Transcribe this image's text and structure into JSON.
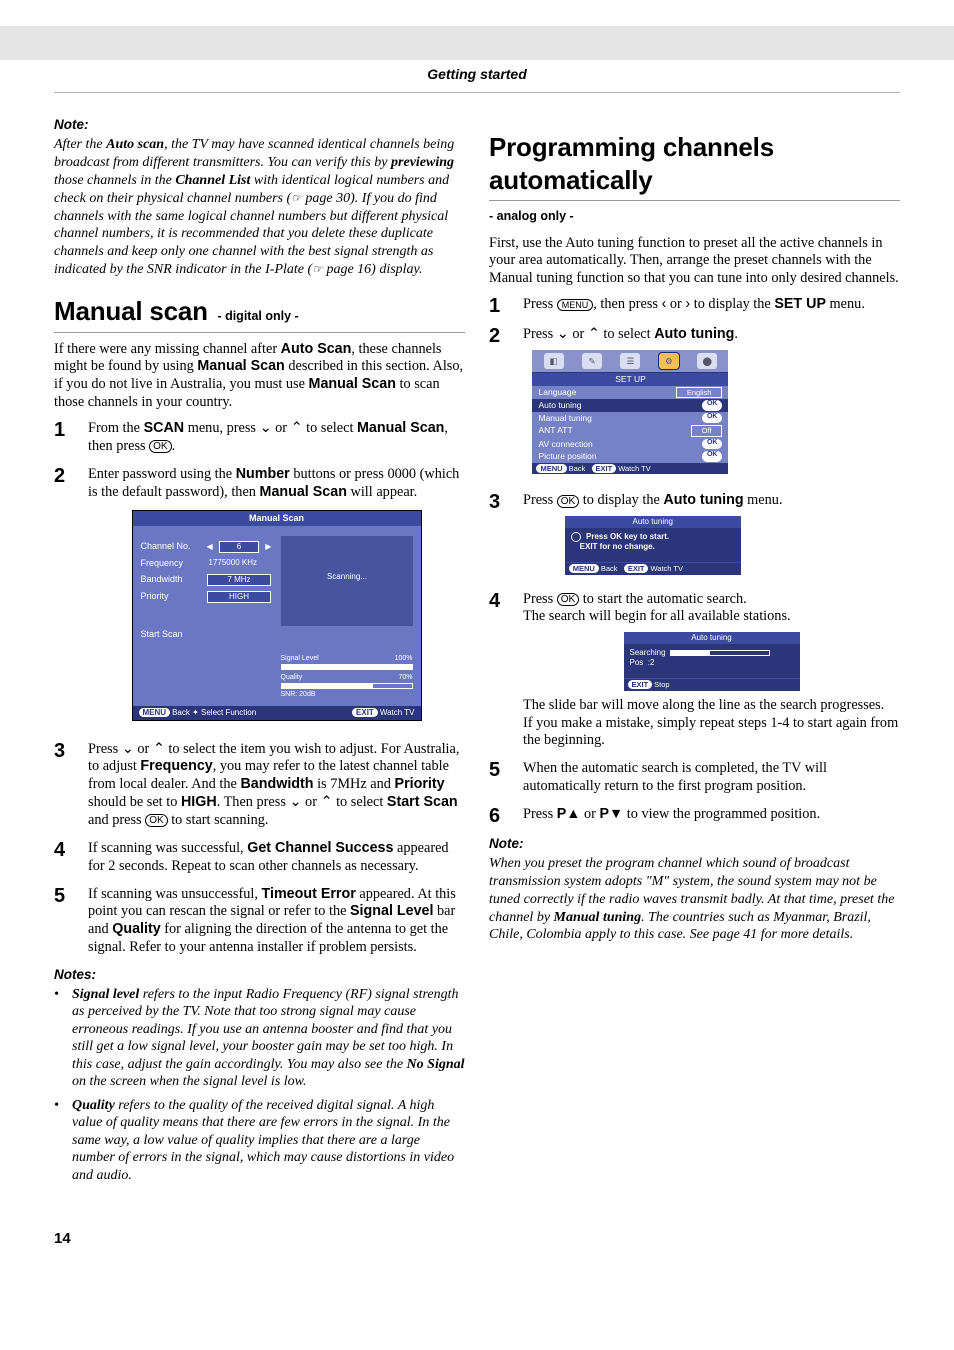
{
  "header": {
    "section": "Getting started"
  },
  "left": {
    "note_head": "Note:",
    "note_body": "After the Auto scan, the TV may have scanned identical channels being broadcast from different transmitters. You can verify this by previewing those channels in the Channel List with identical logical numbers and check on their physical channel numbers (☞ page 30). If you do find channels with the same logical channel numbers but different physical channel numbers, it is recommended that you delete these duplicate channels and keep only one channel with the best signal strength as indicated by the SNR indicator in the I-Plate (☞ page 16) display.",
    "h2": "Manual scan",
    "h2_sub": "- digital only -",
    "intro": "If there were any missing channel after Auto Scan, these channels might be found by using Manual Scan described in this section. Also, if you do not live in Australia, you must use Manual Scan to scan those channels in your country.",
    "steps": {
      "s1": "From the SCAN menu, press ⌄ or ⌃ to select Manual Scan, then press OK.",
      "s2": "Enter password using the Number buttons or press 0000 (which is the default password), then Manual Scan will appear.",
      "s3": "Press ⌄ or ⌃ to select the item you wish to adjust. For Australia, to adjust Frequency, you may refer to the latest channel table from local dealer. And the Bandwidth is 7MHz and Priority should be set to HIGH. Then press ⌄ or ⌃ to select Start Scan and press OK to start scanning.",
      "s4": "If scanning was successful, Get Channel Success appeared for 2 seconds. Repeat to scan other channels as necessary.",
      "s5": "If scanning was unsuccessful, Timeout Error appeared. At this point you can rescan the signal or refer to the Signal Level bar and Quality for aligning the direction of the antenna to get the signal. Refer to your antenna installer if problem persists."
    },
    "notes_head": "Notes:",
    "notes": {
      "n1": "Signal level refers to the input Radio Frequency (RF) signal strength as perceived by the TV. Note that too strong signal may cause erroneous readings. If you use an antenna booster and find that you still get a low signal level, your booster gain may be set too high. In this case, adjust the gain accordingly. You may also see the No Signal on the screen when the signal level is low.",
      "n2": "Quality refers to the quality of the received digital signal. A high value of quality means that there are few errors in the signal. In the same way, a low value of quality implies that there are a large number of errors in the signal, which may cause distortions in video and audio."
    },
    "osd": {
      "title": "Manual Scan",
      "channel_no_label": "Channel No.",
      "channel_no_value": "6",
      "frequency_label": "Frequency",
      "frequency_value": "1775000 KHz",
      "bandwidth_label": "Bandwidth",
      "bandwidth_value": "7 MHz",
      "priority_label": "Priority",
      "priority_value": "HIGH",
      "start_scan": "Start Scan",
      "scanning": "Scanning...",
      "signal_level": "Signal Level",
      "signal_level_pct": "100%",
      "quality": "Quality",
      "quality_pct": "70%",
      "snr": "SNR: 20dB",
      "footer_back": "Back",
      "footer_select": "Select Function",
      "footer_watch": "Watch TV",
      "menu_pill": "MENU",
      "exit_pill": "EXIT"
    }
  },
  "right": {
    "h2": "Programming channels automatically",
    "h2_sub": "- analog only -",
    "intro": "First, use the Auto tuning function to preset all the active channels in your area automatically. Then, arrange the preset channels with the Manual tuning function so that you can tune into only desired channels.",
    "steps": {
      "s1": "Press MENU, then press ‹ or › to display the SET UP menu.",
      "s2": "Press ⌄ or ⌃ to select Auto tuning.",
      "s3": "Press OK to display the Auto tuning menu.",
      "s4a": "Press OK to start the automatic search.",
      "s4b": "The search will begin for all available stations.",
      "s4c": "The slide bar will move along the line as the search progresses.",
      "s4d": "If you make a mistake, simply repeat steps 1-4 to start again from the beginning.",
      "s5": "When the automatic search is completed, the TV will automatically return to the first program position.",
      "s6": "Press P▲ or P▼ to view the programmed position."
    },
    "note_head": "Note:",
    "note_body": "When you preset the program channel which sound of broadcast transmission system adopts \"M\" system, the sound system may not be tuned correctly if the radio waves transmit badly. At that time, preset the channel by Manual tuning. The countries such as Myanmar, Brazil, Chile, Colombia apply to this case. See page 41 for more details.",
    "setup": {
      "title": "SET UP",
      "language_label": "Language",
      "language_value": "English",
      "auto_tuning": "Auto tuning",
      "manual_tuning": "Manual tuning",
      "ant_att_label": "ANT ATT",
      "ant_att_value": "Off",
      "av_connection": "AV connection",
      "picture_position": "Picture position",
      "ok": "OK",
      "footer_back": "Back",
      "footer_watch": "Watch TV",
      "menu_pill": "MENU",
      "exit_pill": "EXIT"
    },
    "mini1": {
      "title": "Auto tuning",
      "line1": "Press OK key to start.",
      "line2": "EXIT for no change.",
      "footer_back": "Back",
      "footer_watch": "Watch TV",
      "menu_pill": "MENU",
      "exit_pill": "EXIT"
    },
    "mini2": {
      "title": "Auto tuning",
      "searching": "Searching",
      "pos_label": "Pos",
      "pos_value": ":2",
      "footer_stop": "Stop",
      "exit_pill": "EXIT"
    }
  },
  "page_number": "14"
}
